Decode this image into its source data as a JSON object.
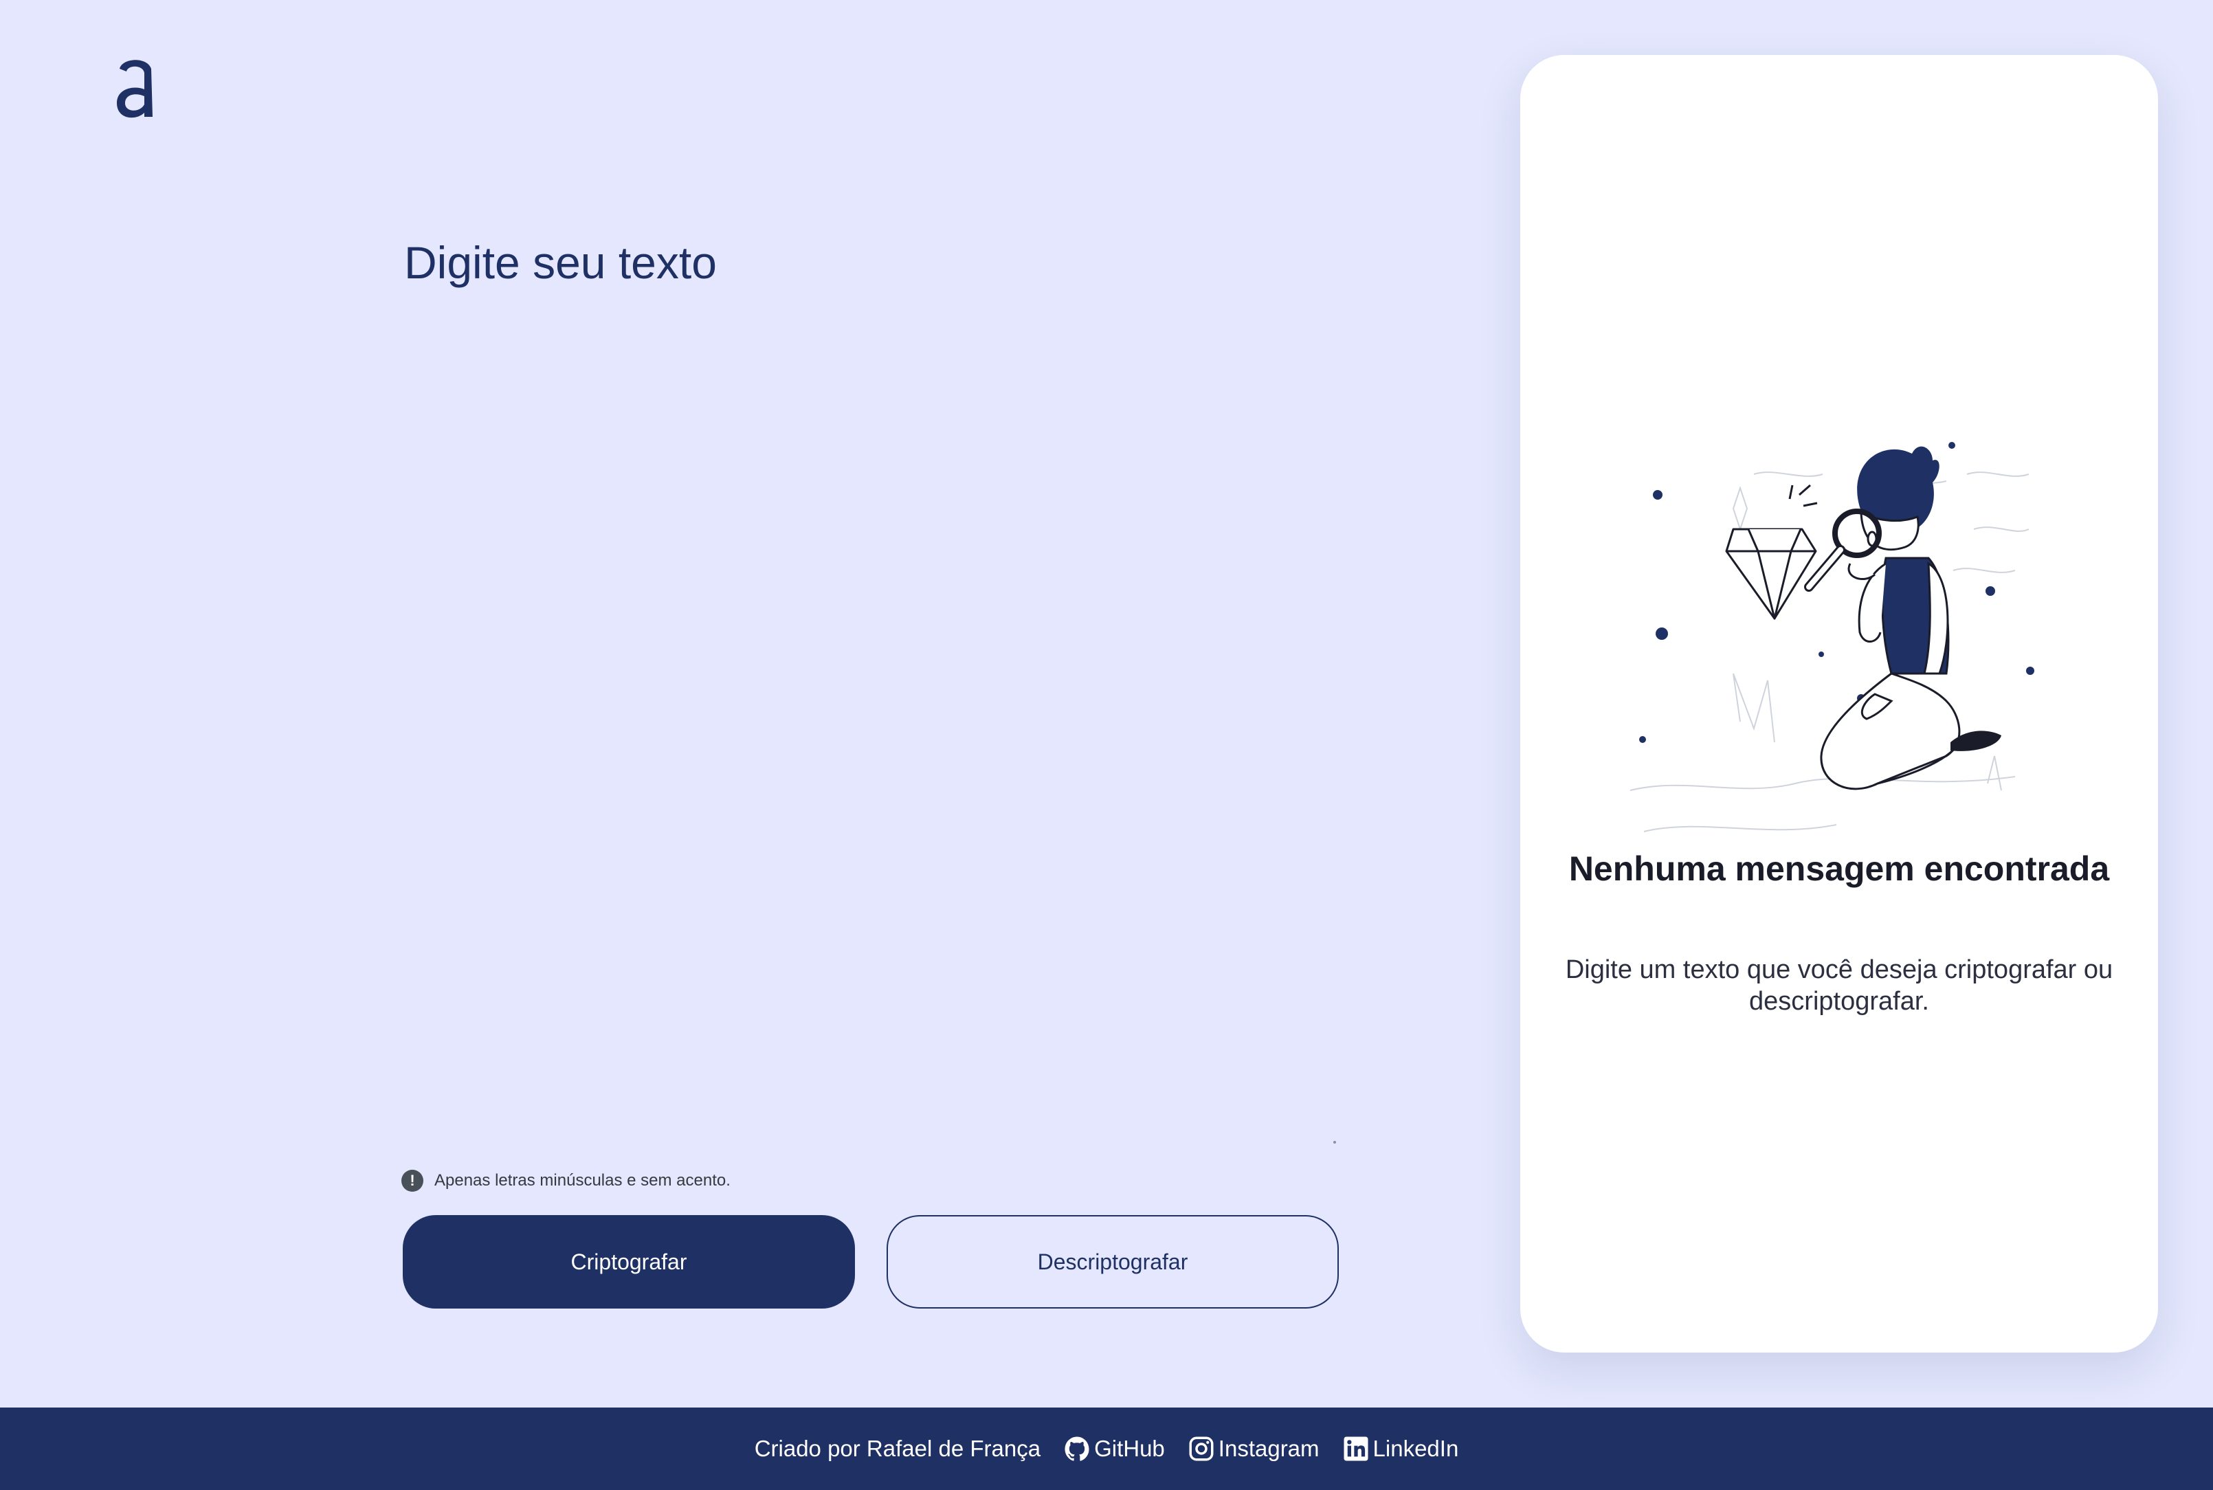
{
  "logo": {
    "icon": "alura-a-logo",
    "letter": "a"
  },
  "input": {
    "placeholder": "Digite seu texto",
    "value": ""
  },
  "hint": {
    "icon": "exclamation-icon",
    "symbol": "!",
    "text": "Apenas letras minúsculas e sem acento."
  },
  "buttons": {
    "encrypt": "Criptografar",
    "decrypt": "Descriptografar"
  },
  "result": {
    "illustration": "person-with-magnifying-glass-and-diamond",
    "title": "Nenhuma mensagem encontrada",
    "body": "Digite um texto que você deseja criptografar ou descriptografar."
  },
  "footer": {
    "credit": "Criado por Rafael de França",
    "links": [
      {
        "label": "GitHub",
        "icon": "github-icon"
      },
      {
        "label": "Instagram",
        "icon": "instagram-icon"
      },
      {
        "label": "LinkedIn",
        "icon": "linkedin-icon"
      }
    ]
  },
  "colors": {
    "background": "#e4e7fd",
    "primary": "#1f3164",
    "card": "#ffffff"
  }
}
